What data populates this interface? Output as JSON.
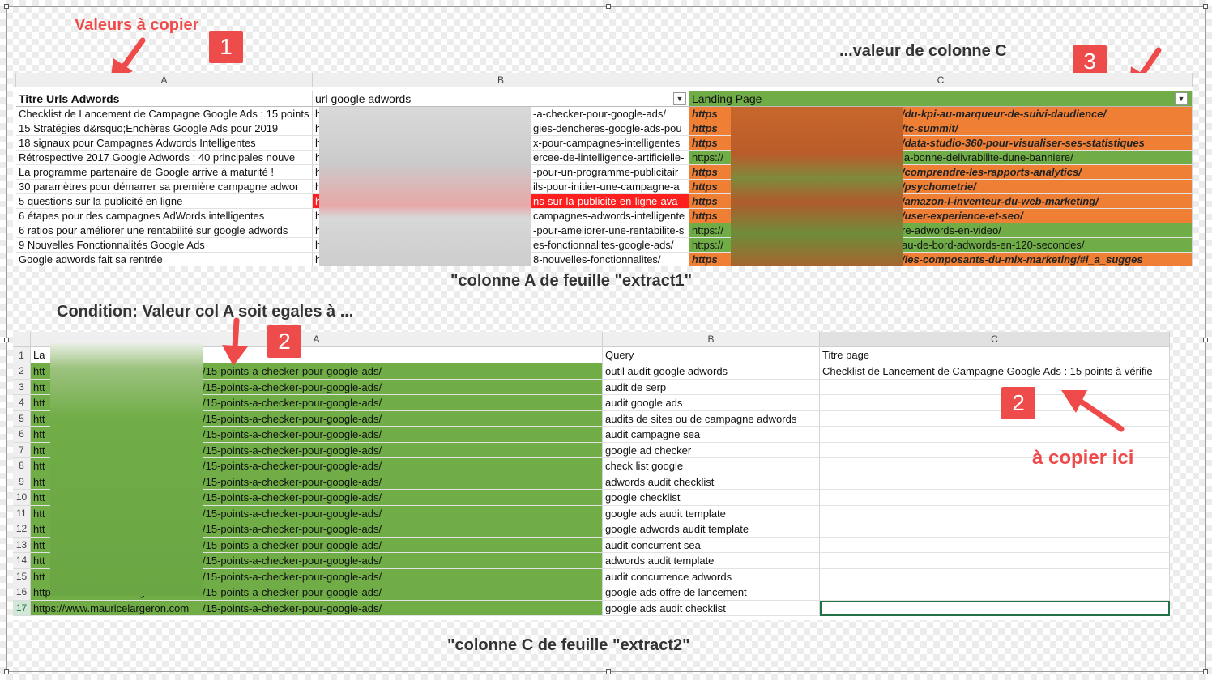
{
  "annotations": {
    "values_to_copy": "Valeurs à copier",
    "col_c_value": "...valeur de colonne C",
    "sheet1_caption": "\"colonne A de feuille \"extract1\"",
    "condition": "Condition: Valeur col A soit egales à ...",
    "copy_here": "à copier ici",
    "sheet2_caption": "\"colonne C de feuille \"extract2\"",
    "badge_1": "1",
    "badge_2a": "2",
    "badge_2b": "2",
    "badge_3": "3"
  },
  "colors": {
    "orange": "#ef7f34",
    "green": "#70ad47",
    "red": "#ff1f1f",
    "annotation_red": "#ee4b4b",
    "selection": "#217346"
  },
  "sheet1": {
    "col_letters": [
      "A",
      "B",
      "C"
    ],
    "headers": [
      "Titre Urls Adwords",
      "url google adwords",
      "Landing Page"
    ],
    "rows": [
      {
        "a": "Checklist de Lancement de Campagne Google Ads : 15 points",
        "b_start": "h",
        "b_end": "-a-checker-pour-google-ads/",
        "c_start": "https",
        "c_end": "/du-kpi-au-marqueur-de-suivi-daudience/",
        "fill": "orange"
      },
      {
        "a": "15 Stratégies d&rsquo;Enchères Google Ads pour 2019",
        "b_start": "h",
        "b_end": "gies-dencheres-google-ads-pou",
        "c_start": "https",
        "c_end": "/tc-summit/",
        "fill": "orange"
      },
      {
        "a": "18 signaux pour Campagnes Adwords Intelligentes",
        "b_start": "h",
        "b_end": "x-pour-campagnes-intelligentes",
        "c_start": "https",
        "c_end": "/data-studio-360-pour-visualiser-ses-statistiques",
        "fill": "orange"
      },
      {
        "a": "Rétrospective 2017 Google Adwords : 40 principales nouve",
        "b_start": "h",
        "b_end": "ercee-de-lintelligence-artificielle-",
        "c_start": "https://",
        "c_end": "la-bonne-delivrabilite-dune-banniere/",
        "fill": "green"
      },
      {
        "a": "La programme partenaire de Google arrive à maturité !",
        "b_start": "h",
        "b_end": "-pour-un-programme-publicitair",
        "c_start": "https",
        "c_end": "/comprendre-les-rapports-analytics/",
        "fill": "orange"
      },
      {
        "a": "30 paramètres pour démarrer sa première campagne adwor",
        "b_start": "h",
        "b_end": "ils-pour-initier-une-campagne-a",
        "c_start": "https",
        "c_end": "/psychometrie/",
        "fill": "orange"
      },
      {
        "a": "5 questions sur la publicité en ligne",
        "b_start": "h",
        "b_end": "ns-sur-la-publicite-en-ligne-ava",
        "c_start": "https",
        "c_end": "/amazon-l-inventeur-du-web-marketing/",
        "fill": "orange",
        "red": true
      },
      {
        "a": "6 étapes pour des campagnes AdWords intelligentes",
        "b_start": "h",
        "b_end": "campagnes-adwords-intelligente",
        "c_start": "https",
        "c_end": "/user-experience-et-seo/",
        "fill": "orange"
      },
      {
        "a": "6 ratios pour améliorer une rentabilité sur google adwords",
        "b_start": "h",
        "b_end": "-pour-ameliorer-une-rentabilite-s",
        "c_start": "https://",
        "c_end": "re-adwords-en-video/",
        "fill": "green"
      },
      {
        "a": "9 Nouvelles Fonctionnalités Google Ads",
        "b_start": "h",
        "b_end": "es-fonctionnalites-google-ads/",
        "c_start": "https://",
        "c_end": "au-de-bord-adwords-en-120-secondes/",
        "fill": "green"
      },
      {
        "a": "Google adwords fait sa rentrée",
        "b_start": "h",
        "b_end": "8-nouvelles-fonctionnalites/",
        "c_start": "https",
        "c_end": "/les-composants-du-mix-marketing/#l_a_sugges",
        "fill": "orange"
      }
    ]
  },
  "sheet2": {
    "col_letters": [
      "A",
      "B",
      "C"
    ],
    "header": {
      "row": "1",
      "a": "La",
      "b": "Query",
      "c": "Titre page"
    },
    "a_prefix": "htt",
    "a_suffix": "/15-points-a-checker-pour-google-ads/",
    "a_full_prefix": "https://www.mauricelargeron.com",
    "c_row2": "Checklist de Lancement de Campagne Google Ads : 15 points à vérifie",
    "rows": [
      {
        "n": "2",
        "b": "outil audit google adwords"
      },
      {
        "n": "3",
        "b": "audit de serp"
      },
      {
        "n": "4",
        "b": "audit google ads"
      },
      {
        "n": "5",
        "b": "audits de sites ou de campagne adwords"
      },
      {
        "n": "6",
        "b": "audit campagne sea"
      },
      {
        "n": "7",
        "b": "google ad checker"
      },
      {
        "n": "8",
        "b": "check list google"
      },
      {
        "n": "9",
        "b": "adwords audit checklist"
      },
      {
        "n": "10",
        "b": "google checklist"
      },
      {
        "n": "11",
        "b": "google ads audit template"
      },
      {
        "n": "12",
        "b": "google adwords audit template"
      },
      {
        "n": "13",
        "b": "audit concurrent sea"
      },
      {
        "n": "14",
        "b": "adwords audit template"
      },
      {
        "n": "15",
        "b": "audit concurrence adwords"
      },
      {
        "n": "16",
        "b": "google ads offre de lancement"
      },
      {
        "n": "17",
        "b": "google ads audit checklist"
      }
    ]
  }
}
